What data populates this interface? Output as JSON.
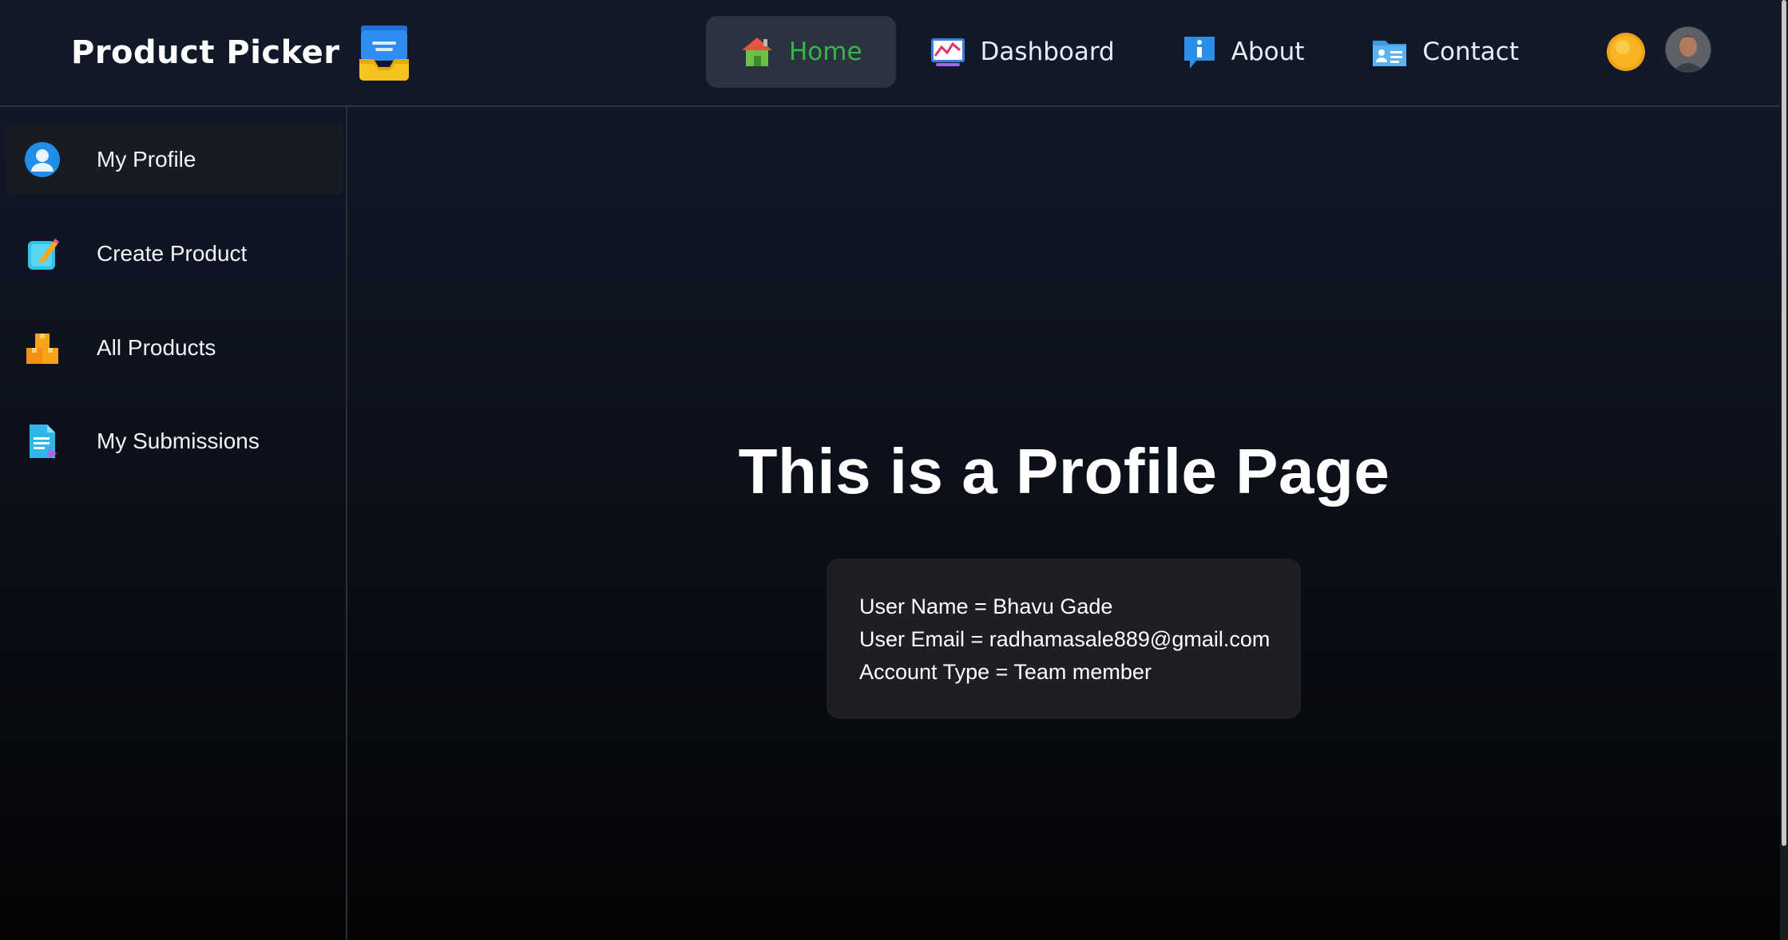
{
  "brand": {
    "title": "Product Picker",
    "icon": "inbox-tray-icon"
  },
  "nav": {
    "items": [
      {
        "label": "Home",
        "icon": "house-icon",
        "active": true
      },
      {
        "label": "Dashboard",
        "icon": "chart-icon",
        "active": false
      },
      {
        "label": "About",
        "icon": "info-icon",
        "active": false
      },
      {
        "label": "Contact",
        "icon": "contact-card-icon",
        "active": false
      }
    ],
    "theme_toggle_icon": "sun-icon",
    "avatar": "user-avatar"
  },
  "sidebar": {
    "items": [
      {
        "label": "My Profile",
        "icon": "user-circle-icon",
        "active": true
      },
      {
        "label": "Create Product",
        "icon": "edit-note-icon",
        "active": false
      },
      {
        "label": "All Products",
        "icon": "boxes-icon",
        "active": false
      },
      {
        "label": "My Submissions",
        "icon": "document-icon",
        "active": false
      }
    ]
  },
  "main": {
    "title": "This is a Profile Page",
    "profile": {
      "user_name": "User Name = Bhavu Gade",
      "user_email": "User Email = radhamasale889@gmail.com",
      "account_type": "Account Type = Team member"
    }
  },
  "colors": {
    "active_nav_text": "#38b54a",
    "header_bg": "#111827",
    "card_bg": "#1d1f25"
  }
}
